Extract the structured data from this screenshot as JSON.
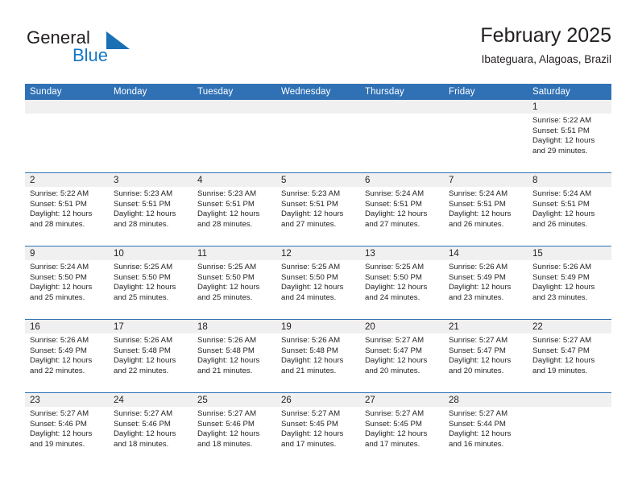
{
  "brand": {
    "name_part1": "General",
    "name_part2": "Blue",
    "triangle_icon": "triangle-flag-icon",
    "color_dark": "#231f20",
    "color_blue": "#1277c4"
  },
  "header": {
    "title": "February 2025",
    "subtitle": "Ibateguara, Alagoas, Brazil"
  },
  "theme": {
    "header_blue": "#3071b5",
    "daynum_band": "#f0f0f0",
    "text": "#231f20"
  },
  "weekday_headers": [
    "Sunday",
    "Monday",
    "Tuesday",
    "Wednesday",
    "Thursday",
    "Friday",
    "Saturday"
  ],
  "labels": {
    "sunrise_prefix": "Sunrise:",
    "sunset_prefix": "Sunset:",
    "daylight_prefix": "Daylight:"
  },
  "weeks": [
    [
      {
        "day": "",
        "sunrise": "",
        "sunset": "",
        "daylight_line1": "",
        "daylight_line2": "",
        "empty": true
      },
      {
        "day": "",
        "sunrise": "",
        "sunset": "",
        "daylight_line1": "",
        "daylight_line2": "",
        "empty": true
      },
      {
        "day": "",
        "sunrise": "",
        "sunset": "",
        "daylight_line1": "",
        "daylight_line2": "",
        "empty": true
      },
      {
        "day": "",
        "sunrise": "",
        "sunset": "",
        "daylight_line1": "",
        "daylight_line2": "",
        "empty": true
      },
      {
        "day": "",
        "sunrise": "",
        "sunset": "",
        "daylight_line1": "",
        "daylight_line2": "",
        "empty": true
      },
      {
        "day": "",
        "sunrise": "",
        "sunset": "",
        "daylight_line1": "",
        "daylight_line2": "",
        "empty": true
      },
      {
        "day": "1",
        "sunrise": "Sunrise: 5:22 AM",
        "sunset": "Sunset: 5:51 PM",
        "daylight_line1": "Daylight: 12 hours",
        "daylight_line2": "and 29 minutes.",
        "empty": false
      }
    ],
    [
      {
        "day": "2",
        "sunrise": "Sunrise: 5:22 AM",
        "sunset": "Sunset: 5:51 PM",
        "daylight_line1": "Daylight: 12 hours",
        "daylight_line2": "and 28 minutes.",
        "empty": false
      },
      {
        "day": "3",
        "sunrise": "Sunrise: 5:23 AM",
        "sunset": "Sunset: 5:51 PM",
        "daylight_line1": "Daylight: 12 hours",
        "daylight_line2": "and 28 minutes.",
        "empty": false
      },
      {
        "day": "4",
        "sunrise": "Sunrise: 5:23 AM",
        "sunset": "Sunset: 5:51 PM",
        "daylight_line1": "Daylight: 12 hours",
        "daylight_line2": "and 28 minutes.",
        "empty": false
      },
      {
        "day": "5",
        "sunrise": "Sunrise: 5:23 AM",
        "sunset": "Sunset: 5:51 PM",
        "daylight_line1": "Daylight: 12 hours",
        "daylight_line2": "and 27 minutes.",
        "empty": false
      },
      {
        "day": "6",
        "sunrise": "Sunrise: 5:24 AM",
        "sunset": "Sunset: 5:51 PM",
        "daylight_line1": "Daylight: 12 hours",
        "daylight_line2": "and 27 minutes.",
        "empty": false
      },
      {
        "day": "7",
        "sunrise": "Sunrise: 5:24 AM",
        "sunset": "Sunset: 5:51 PM",
        "daylight_line1": "Daylight: 12 hours",
        "daylight_line2": "and 26 minutes.",
        "empty": false
      },
      {
        "day": "8",
        "sunrise": "Sunrise: 5:24 AM",
        "sunset": "Sunset: 5:51 PM",
        "daylight_line1": "Daylight: 12 hours",
        "daylight_line2": "and 26 minutes.",
        "empty": false
      }
    ],
    [
      {
        "day": "9",
        "sunrise": "Sunrise: 5:24 AM",
        "sunset": "Sunset: 5:50 PM",
        "daylight_line1": "Daylight: 12 hours",
        "daylight_line2": "and 25 minutes.",
        "empty": false
      },
      {
        "day": "10",
        "sunrise": "Sunrise: 5:25 AM",
        "sunset": "Sunset: 5:50 PM",
        "daylight_line1": "Daylight: 12 hours",
        "daylight_line2": "and 25 minutes.",
        "empty": false
      },
      {
        "day": "11",
        "sunrise": "Sunrise: 5:25 AM",
        "sunset": "Sunset: 5:50 PM",
        "daylight_line1": "Daylight: 12 hours",
        "daylight_line2": "and 25 minutes.",
        "empty": false
      },
      {
        "day": "12",
        "sunrise": "Sunrise: 5:25 AM",
        "sunset": "Sunset: 5:50 PM",
        "daylight_line1": "Daylight: 12 hours",
        "daylight_line2": "and 24 minutes.",
        "empty": false
      },
      {
        "day": "13",
        "sunrise": "Sunrise: 5:25 AM",
        "sunset": "Sunset: 5:50 PM",
        "daylight_line1": "Daylight: 12 hours",
        "daylight_line2": "and 24 minutes.",
        "empty": false
      },
      {
        "day": "14",
        "sunrise": "Sunrise: 5:26 AM",
        "sunset": "Sunset: 5:49 PM",
        "daylight_line1": "Daylight: 12 hours",
        "daylight_line2": "and 23 minutes.",
        "empty": false
      },
      {
        "day": "15",
        "sunrise": "Sunrise: 5:26 AM",
        "sunset": "Sunset: 5:49 PM",
        "daylight_line1": "Daylight: 12 hours",
        "daylight_line2": "and 23 minutes.",
        "empty": false
      }
    ],
    [
      {
        "day": "16",
        "sunrise": "Sunrise: 5:26 AM",
        "sunset": "Sunset: 5:49 PM",
        "daylight_line1": "Daylight: 12 hours",
        "daylight_line2": "and 22 minutes.",
        "empty": false
      },
      {
        "day": "17",
        "sunrise": "Sunrise: 5:26 AM",
        "sunset": "Sunset: 5:48 PM",
        "daylight_line1": "Daylight: 12 hours",
        "daylight_line2": "and 22 minutes.",
        "empty": false
      },
      {
        "day": "18",
        "sunrise": "Sunrise: 5:26 AM",
        "sunset": "Sunset: 5:48 PM",
        "daylight_line1": "Daylight: 12 hours",
        "daylight_line2": "and 21 minutes.",
        "empty": false
      },
      {
        "day": "19",
        "sunrise": "Sunrise: 5:26 AM",
        "sunset": "Sunset: 5:48 PM",
        "daylight_line1": "Daylight: 12 hours",
        "daylight_line2": "and 21 minutes.",
        "empty": false
      },
      {
        "day": "20",
        "sunrise": "Sunrise: 5:27 AM",
        "sunset": "Sunset: 5:47 PM",
        "daylight_line1": "Daylight: 12 hours",
        "daylight_line2": "and 20 minutes.",
        "empty": false
      },
      {
        "day": "21",
        "sunrise": "Sunrise: 5:27 AM",
        "sunset": "Sunset: 5:47 PM",
        "daylight_line1": "Daylight: 12 hours",
        "daylight_line2": "and 20 minutes.",
        "empty": false
      },
      {
        "day": "22",
        "sunrise": "Sunrise: 5:27 AM",
        "sunset": "Sunset: 5:47 PM",
        "daylight_line1": "Daylight: 12 hours",
        "daylight_line2": "and 19 minutes.",
        "empty": false
      }
    ],
    [
      {
        "day": "23",
        "sunrise": "Sunrise: 5:27 AM",
        "sunset": "Sunset: 5:46 PM",
        "daylight_line1": "Daylight: 12 hours",
        "daylight_line2": "and 19 minutes.",
        "empty": false
      },
      {
        "day": "24",
        "sunrise": "Sunrise: 5:27 AM",
        "sunset": "Sunset: 5:46 PM",
        "daylight_line1": "Daylight: 12 hours",
        "daylight_line2": "and 18 minutes.",
        "empty": false
      },
      {
        "day": "25",
        "sunrise": "Sunrise: 5:27 AM",
        "sunset": "Sunset: 5:46 PM",
        "daylight_line1": "Daylight: 12 hours",
        "daylight_line2": "and 18 minutes.",
        "empty": false
      },
      {
        "day": "26",
        "sunrise": "Sunrise: 5:27 AM",
        "sunset": "Sunset: 5:45 PM",
        "daylight_line1": "Daylight: 12 hours",
        "daylight_line2": "and 17 minutes.",
        "empty": false
      },
      {
        "day": "27",
        "sunrise": "Sunrise: 5:27 AM",
        "sunset": "Sunset: 5:45 PM",
        "daylight_line1": "Daylight: 12 hours",
        "daylight_line2": "and 17 minutes.",
        "empty": false
      },
      {
        "day": "28",
        "sunrise": "Sunrise: 5:27 AM",
        "sunset": "Sunset: 5:44 PM",
        "daylight_line1": "Daylight: 12 hours",
        "daylight_line2": "and 16 minutes.",
        "empty": false
      },
      {
        "day": "",
        "sunrise": "",
        "sunset": "",
        "daylight_line1": "",
        "daylight_line2": "",
        "empty": true
      }
    ]
  ]
}
